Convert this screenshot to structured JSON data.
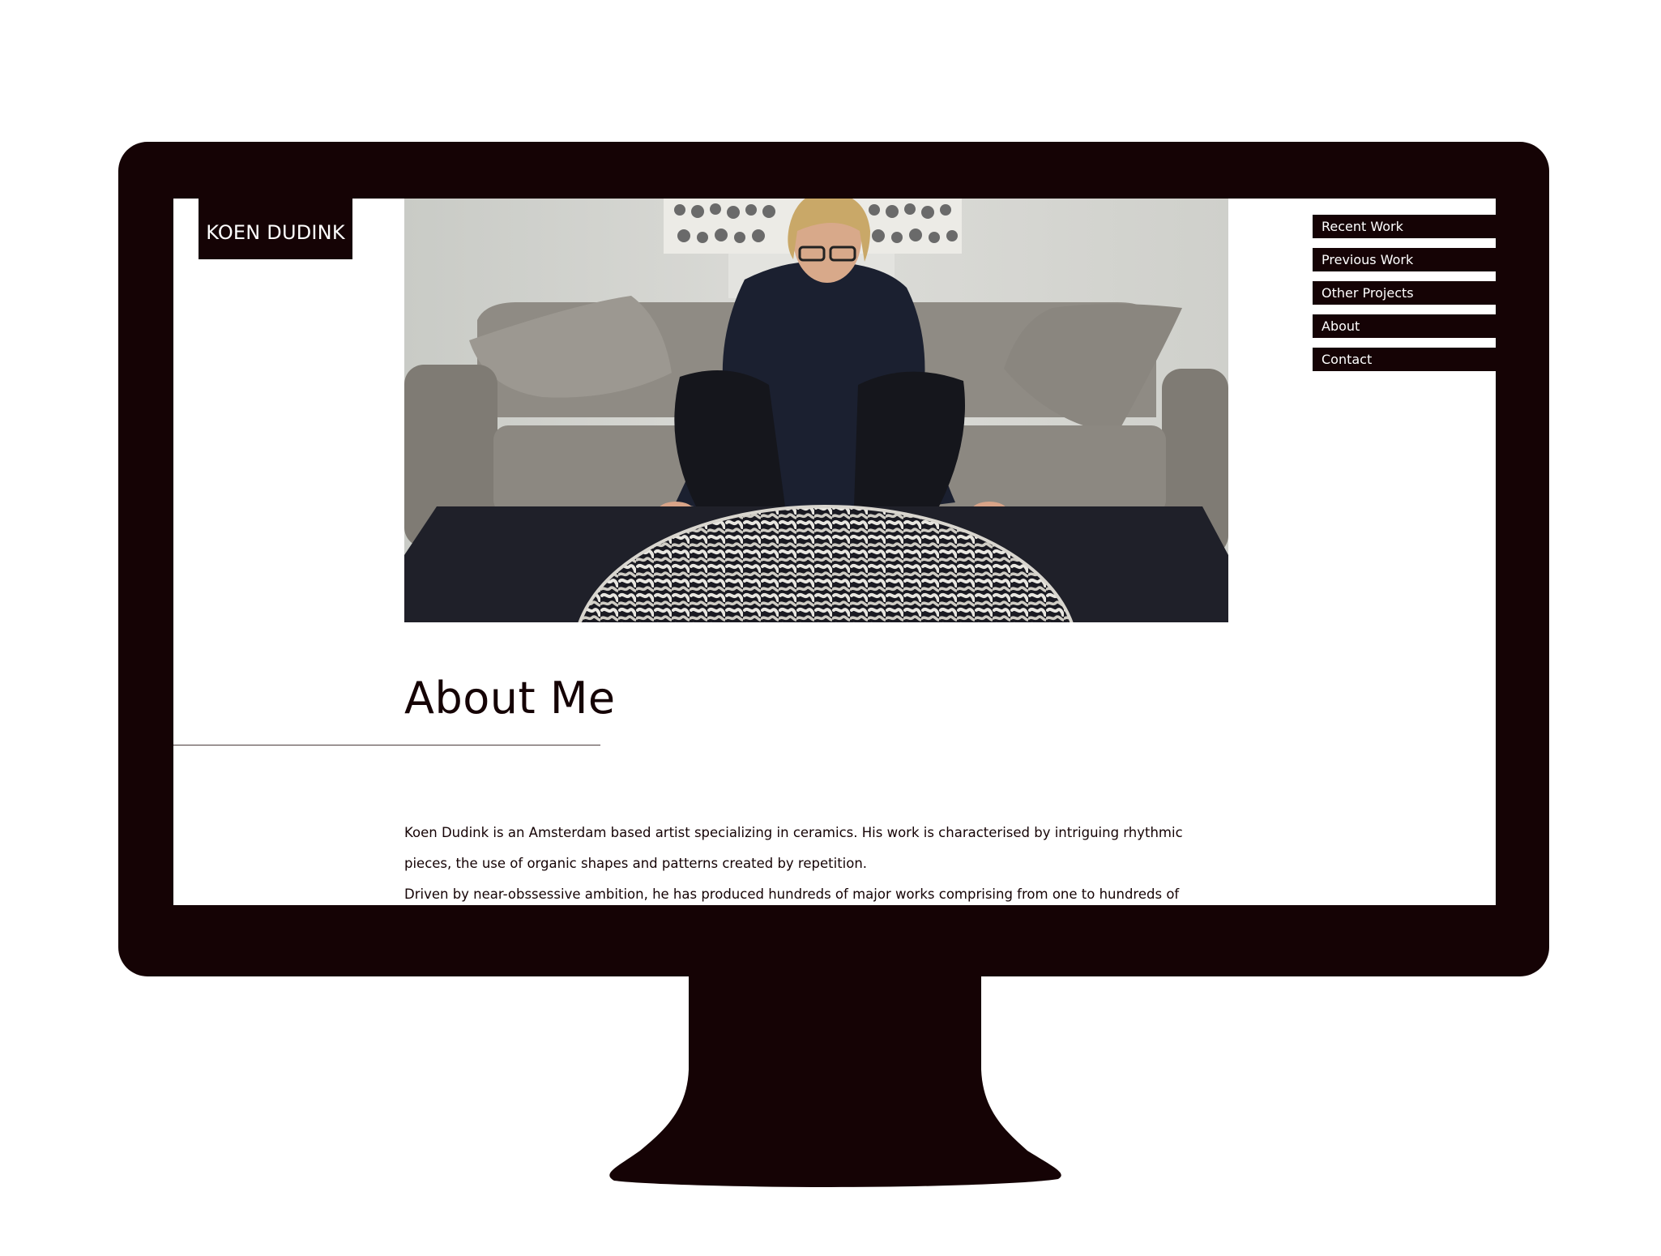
{
  "site": {
    "logo_text": "KOEN DUDINK"
  },
  "nav": {
    "items": [
      {
        "label": "Recent Work"
      },
      {
        "label": "Previous Work"
      },
      {
        "label": "Other Projects"
      },
      {
        "label": "About"
      },
      {
        "label": "Contact"
      }
    ]
  },
  "hero": {
    "alt": "Artist kneeling behind a dark table holding a round white ceramic piece, in front of a grey sofa"
  },
  "main": {
    "title": "About Me",
    "paragraphs": [
      "Koen Dudink is an Amsterdam based artist specializing in ceramics. His work is characterised by intriguing rhythmic pieces, the use of organic shapes and patterns created by repetition.",
      "Driven by near-obssessive ambition, he has produced hundreds of major works comprising from one to hundreds of individual"
    ]
  },
  "colors": {
    "frame": "#150305",
    "background": "#ffffff",
    "text": "#150305"
  }
}
